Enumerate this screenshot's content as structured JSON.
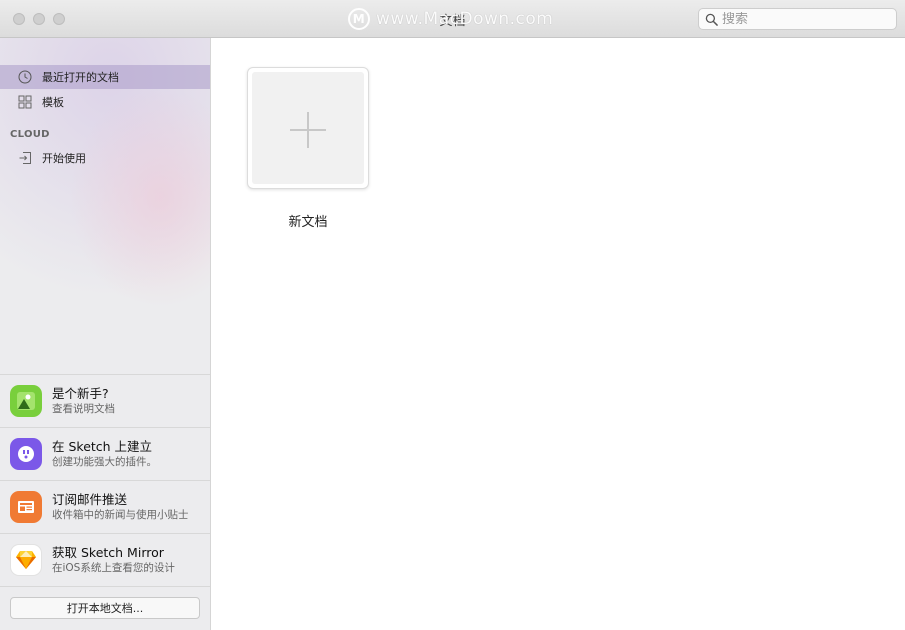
{
  "window": {
    "title": "文档",
    "watermark": "www.MacDown.com"
  },
  "search": {
    "placeholder": "搜索"
  },
  "sidebar": {
    "items": [
      {
        "label": "最近打开的文档",
        "icon": "clock-icon",
        "selected": true
      },
      {
        "label": "模板",
        "icon": "templates-icon",
        "selected": false
      }
    ],
    "section_label": "CLOUD",
    "cloud_items": [
      {
        "label": "开始使用",
        "icon": "sign-in-icon"
      }
    ],
    "promos": [
      {
        "title": "是个新手?",
        "subtitle": "查看说明文档",
        "icon": "image-guide-icon",
        "color": "#7ccf3a"
      },
      {
        "title": "在 Sketch 上建立",
        "subtitle": "创建功能强大的插件。",
        "icon": "plugin-socket-icon",
        "color": "#7b58e8"
      },
      {
        "title": "订阅邮件推送",
        "subtitle": "收件箱中的新闻与使用小贴士",
        "icon": "newsletter-icon",
        "color": "#f07a33"
      },
      {
        "title": "获取 Sketch Mirror",
        "subtitle": "在iOS系统上查看您的设计",
        "icon": "sketch-diamond-icon",
        "color": "#f5b52e"
      }
    ],
    "open_button": "打开本地文档..."
  },
  "main": {
    "new_document_label": "新文档"
  }
}
